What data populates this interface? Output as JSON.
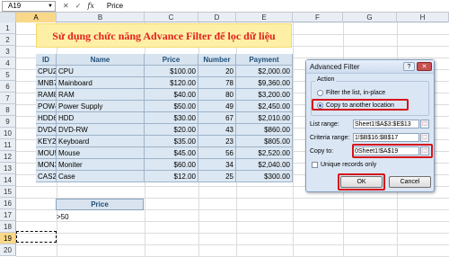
{
  "formula_bar": {
    "name_box": "A19",
    "cancel": "✕",
    "enter": "✓",
    "fx": "fx",
    "value": "Price"
  },
  "columns": [
    "A",
    "B",
    "C",
    "D",
    "E",
    "F",
    "G",
    "H"
  ],
  "rows": [
    "1",
    "2",
    "3",
    "4",
    "5",
    "6",
    "7",
    "8",
    "9",
    "10",
    "11",
    "12",
    "13",
    "14",
    "15",
    "16",
    "17",
    "18",
    "19",
    "20"
  ],
  "title": "Sử dụng chức năng Advance Filter để lọc dữ liệu",
  "table": {
    "headers": [
      "ID",
      "Name",
      "Price",
      "Number",
      "Payment"
    ],
    "rows": [
      [
        "CPU20",
        "CPU",
        "$100.00",
        "20",
        "$2,000.00"
      ],
      [
        "MNB78",
        "Mainboard",
        "$120.00",
        "78",
        "$9,360.00"
      ],
      [
        "RAM80",
        "RAM",
        "$40.00",
        "80",
        "$3,200.00"
      ],
      [
        "POW49",
        "Power Supply",
        "$50.00",
        "49",
        "$2,450.00"
      ],
      [
        "HDD67",
        "HDD",
        "$30.00",
        "67",
        "$2,010.00"
      ],
      [
        "DVD43",
        "DVD-RW",
        "$20.00",
        "43",
        "$860.00"
      ],
      [
        "KEY23",
        "Keyboard",
        "$35.00",
        "23",
        "$805.00"
      ],
      [
        "MOU56",
        "Mouse",
        "$45.00",
        "56",
        "$2,520.00"
      ],
      [
        "MON34",
        "Moniter",
        "$60.00",
        "34",
        "$2,040.00"
      ],
      [
        "CAS25",
        "Case",
        "$12.00",
        "25",
        "$300.00"
      ]
    ]
  },
  "criteria": {
    "header": "Price",
    "value": ">50"
  },
  "dialog": {
    "title": "Advanced Filter",
    "help": "?",
    "close": "✕",
    "action_label": "Action",
    "option_inplace": "Filter the list, in-place",
    "option_copy": "Copy to another location",
    "list_range_label": "List range:",
    "list_range_value": "Sheet1!$A$3:$E$13",
    "criteria_range_label": "Criteria range:",
    "criteria_range_value": "1!$B$16:$B$17",
    "copy_to_label": "Copy to:",
    "copy_to_value": "0Sheet1!$A$19",
    "unique_label": "Unique records only",
    "ok": "OK",
    "cancel": "Cancel"
  }
}
